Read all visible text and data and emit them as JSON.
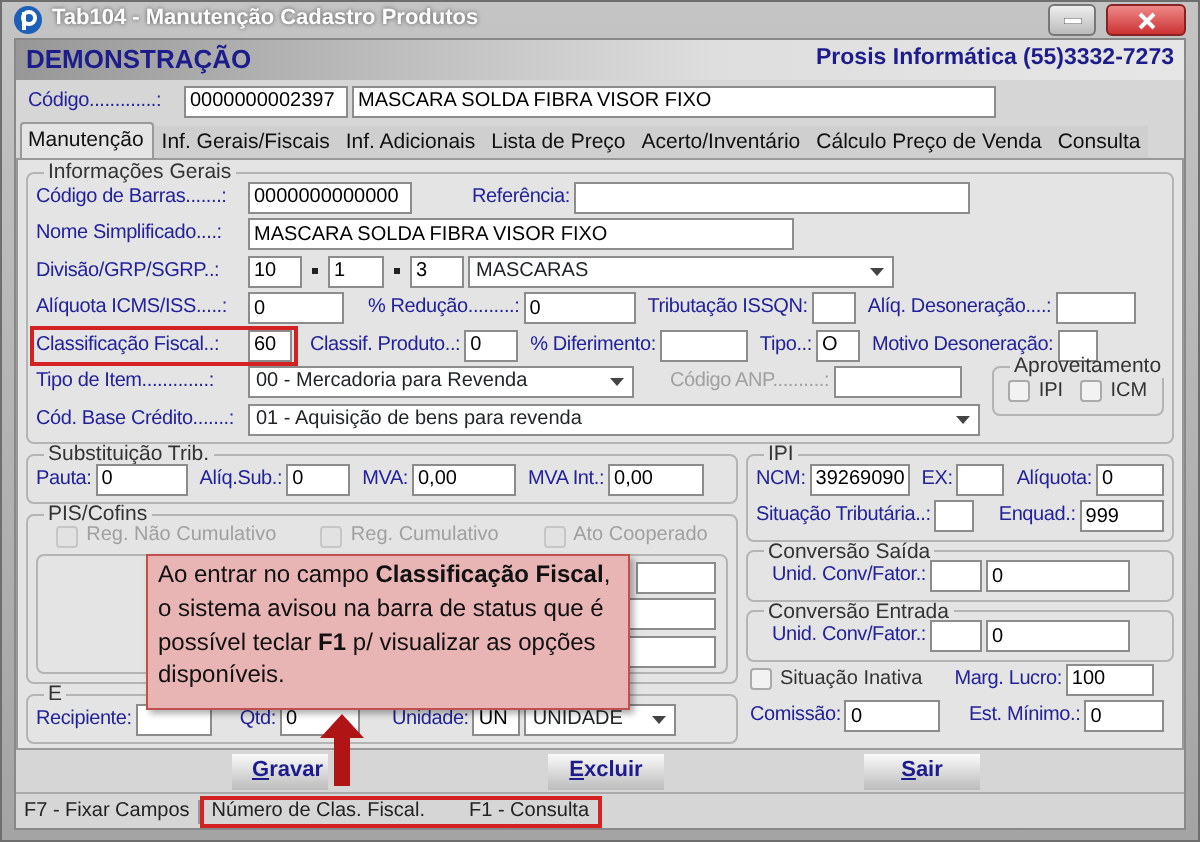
{
  "window": {
    "title": "Tab104 - Manutenção Cadastro Produtos"
  },
  "header": {
    "company": "DEMONSTRAÇÃO",
    "contact": "Prosis Informática (55)3332-7273"
  },
  "product": {
    "label": "Código.............:",
    "code": "0000000002397",
    "name": "MASCARA SOLDA FIBRA VISOR FIXO"
  },
  "tabs": [
    {
      "label": "Manutenção",
      "selected": true
    },
    {
      "label": "Inf. Gerais/Fiscais",
      "selected": false
    },
    {
      "label": "Inf. Adicionais",
      "selected": false
    },
    {
      "label": "Lista de Preço",
      "selected": false
    },
    {
      "label": "Acerto/Inventário",
      "selected": false
    },
    {
      "label": "Cálculo Preço de Venda",
      "selected": false
    },
    {
      "label": "Consulta",
      "selected": false
    }
  ],
  "general": {
    "legend": "Informações Gerais",
    "rows": [
      {
        "items": [
          {
            "kind": "label",
            "text": "Código de Barras.......:"
          },
          {
            "kind": "input",
            "value": "0000000000000"
          },
          {
            "kind": "label",
            "text": "Referência:"
          },
          {
            "kind": "input"
          }
        ]
      },
      {
        "items": [
          {
            "kind": "label",
            "text": "Nome Simplificado....:"
          },
          {
            "kind": "input",
            "value": "MASCARA SOLDA FIBRA VISOR FIXO"
          }
        ]
      },
      {
        "items": [
          {
            "kind": "label",
            "text": "Divisão/GRP/SGRP..:"
          },
          {
            "kind": "split_input",
            "values": [
              "10",
              "1",
              "3"
            ]
          },
          {
            "kind": "select",
            "value": "MASCARAS"
          }
        ]
      },
      {
        "items": [
          {
            "kind": "label",
            "text": "Alíquota ICMS/ISS.....:"
          },
          {
            "kind": "input",
            "value": "0"
          },
          {
            "kind": "label",
            "text": "% Redução.........:"
          },
          {
            "kind": "input",
            "value": "0"
          },
          {
            "kind": "label",
            "text": "Tributação ISSQN:"
          },
          {
            "kind": "input"
          },
          {
            "kind": "label",
            "text": "Alíq. Desoneração....:"
          },
          {
            "kind": "input"
          }
        ]
      },
      {
        "items": [
          {
            "kind": "label",
            "text": "Classificação Fiscal..:",
            "highlighted": true
          },
          {
            "kind": "input",
            "value": "60",
            "highlighted": true
          },
          {
            "kind": "label",
            "text": "Classif. Produto..:"
          },
          {
            "kind": "input",
            "value": "0"
          },
          {
            "kind": "label",
            "text": "% Diferimento:"
          },
          {
            "kind": "input"
          },
          {
            "kind": "label",
            "text": "Tipo..:"
          },
          {
            "kind": "input",
            "value": "O"
          },
          {
            "kind": "label",
            "text": "Motivo Desoneração:"
          },
          {
            "kind": "input"
          }
        ]
      },
      {
        "items": [
          {
            "kind": "label",
            "text": "Tipo de Item.............:"
          },
          {
            "kind": "select",
            "value": "00 - Mercadoria para Revenda"
          },
          {
            "kind": "disabled_label",
            "text": "Código ANP..........:"
          },
          {
            "kind": "input"
          }
        ]
      },
      {
        "items": [
          {
            "kind": "label",
            "text": "Cód. Base Crédito.......:"
          },
          {
            "kind": "select",
            "value": "01 - Aquisição de bens para revenda"
          }
        ]
      }
    ],
    "aproveitamento": {
      "legend": "Aproveitamento",
      "options": [
        {
          "label": "IPI",
          "checked": false,
          "disabled": false
        },
        {
          "label": "ICM",
          "checked": false,
          "disabled": false
        }
      ]
    }
  },
  "substituicao": {
    "legend": "Substituição Trib.",
    "rows": [
      {
        "items": [
          {
            "kind": "label",
            "text": "Pauta:"
          },
          {
            "kind": "input",
            "value": "0"
          },
          {
            "kind": "label",
            "text": "Alíq.Sub.:"
          },
          {
            "kind": "input",
            "value": "0"
          },
          {
            "kind": "label",
            "text": "MVA:"
          },
          {
            "kind": "input",
            "value": "0,00"
          },
          {
            "kind": "label",
            "text": "MVA Int.:"
          },
          {
            "kind": "input",
            "value": "0,00"
          }
        ]
      }
    ]
  },
  "pis_cofins": {
    "legend": "PIS/Cofins",
    "options": [
      {
        "label": "Reg. Não Cumulativo",
        "checked": false,
        "disabled": true
      },
      {
        "label": "Reg. Cumulativo",
        "checked": false,
        "disabled": true
      },
      {
        "label": "Ato Cooperado",
        "checked": false,
        "disabled": true
      }
    ],
    "rows": [
      {
        "items": [
          {
            "kind": "input"
          }
        ]
      },
      {
        "items": [
          {
            "kind": "input"
          }
        ]
      },
      {
        "items": [
          {
            "kind": "input"
          }
        ]
      }
    ]
  },
  "embalagem": {
    "legend": "E",
    "rows": [
      {
        "items": [
          {
            "kind": "label",
            "text": "Recipiente:"
          },
          {
            "kind": "input"
          },
          {
            "kind": "label",
            "text": "Qtd:"
          },
          {
            "kind": "input",
            "value": "0"
          },
          {
            "kind": "label",
            "text": "Unidade:"
          },
          {
            "kind": "input",
            "value": "UN"
          },
          {
            "kind": "select",
            "value": "UNIDADE"
          }
        ]
      }
    ]
  },
  "ipi": {
    "legend": "IPI",
    "rows": [
      {
        "items": [
          {
            "kind": "label",
            "text": "NCM:"
          },
          {
            "kind": "input",
            "value": "39269090"
          },
          {
            "kind": "label",
            "text": "EX:"
          },
          {
            "kind": "input"
          },
          {
            "kind": "label",
            "text": "Alíquota:"
          },
          {
            "kind": "input",
            "value": "0"
          }
        ]
      },
      {
        "items": [
          {
            "kind": "label",
            "text": "Situação Tributária..:"
          },
          {
            "kind": "input"
          },
          {
            "kind": "label",
            "text": "Enquad.:"
          },
          {
            "kind": "input",
            "value": "999"
          }
        ]
      }
    ]
  },
  "conversao_saida": {
    "legend": "Conversão Saída",
    "rows": [
      {
        "items": [
          {
            "kind": "label",
            "text": "Unid. Conv/Fator.:"
          },
          {
            "kind": "input"
          },
          {
            "kind": "input",
            "value": "0"
          }
        ]
      }
    ]
  },
  "conversao_entrada": {
    "legend": "Conversão Entrada",
    "rows": [
      {
        "items": [
          {
            "kind": "label",
            "text": "Unid. Conv/Fator.:"
          },
          {
            "kind": "input"
          },
          {
            "kind": "input",
            "value": "0"
          }
        ]
      }
    ]
  },
  "extras": {
    "rows": [
      {
        "items": [
          {
            "kind": "check",
            "label": "Situação Inativa",
            "checked": false,
            "disabled": false
          },
          {
            "kind": "label",
            "text": "Marg. Lucro:"
          },
          {
            "kind": "input",
            "value": "100"
          }
        ]
      },
      {
        "items": [
          {
            "kind": "label",
            "text": "Comissão:"
          },
          {
            "kind": "input",
            "value": "0"
          },
          {
            "kind": "label",
            "text": "Est. Mínimo.:"
          },
          {
            "kind": "input",
            "value": "0"
          }
        ]
      }
    ]
  },
  "buttons": [
    {
      "label": "Gravar"
    },
    {
      "label": "Excluir"
    },
    {
      "label": "Sair"
    }
  ],
  "status_bar": [
    {
      "text": "F7 - Fixar Campos",
      "highlighted": false
    },
    {
      "text": "Número de Clas. Fiscal.",
      "highlighted": true
    },
    {
      "text": "F1 - Consulta",
      "highlighted": true
    }
  ],
  "callout": {
    "text": "Ao entrar no campo **Classificação  Fiscal**, o sistema avisou na barra de status que é possível teclar **F1** p/ visualizar as opções disponíveis."
  }
}
